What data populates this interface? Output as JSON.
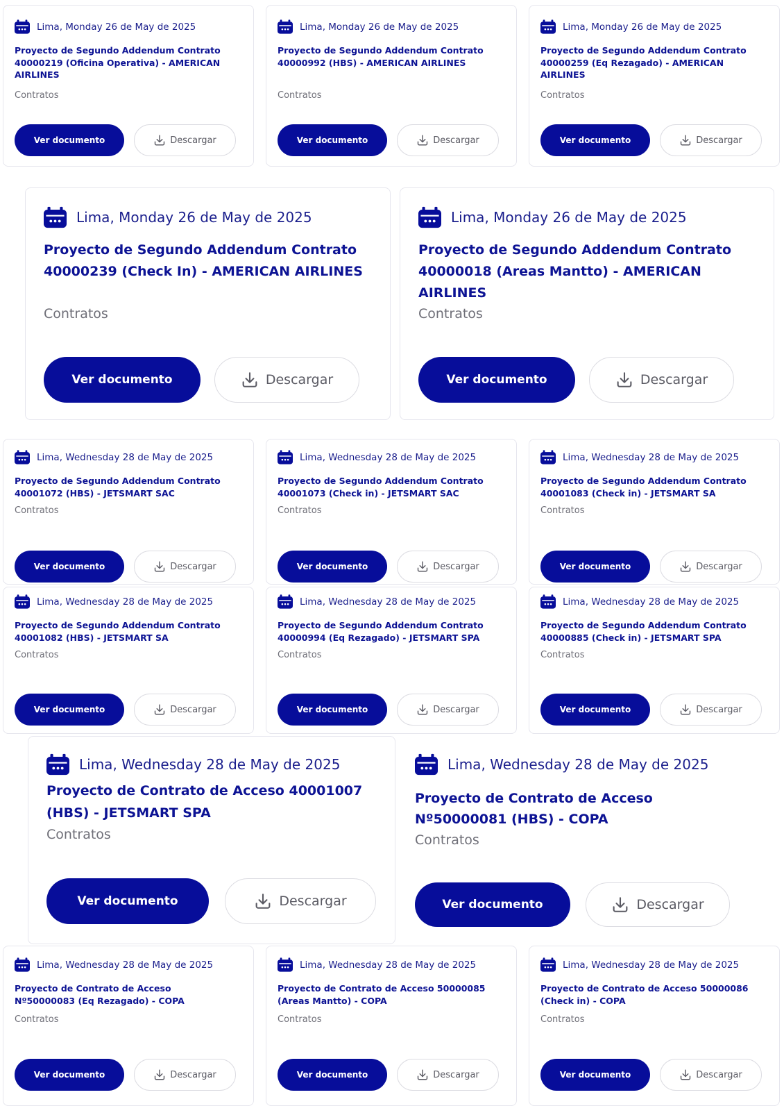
{
  "labels": {
    "view": "Ver documento",
    "download": "Descargar",
    "category": "Contratos"
  },
  "colors": {
    "primary": "#070d9a",
    "title": "#0d1394",
    "muted": "#6f6f78",
    "border": "#e6e6ee"
  },
  "icons": {
    "date": "calendar-icon",
    "download": "download-icon"
  },
  "cards": [
    {
      "date": "Lima, Monday 26 de May de 2025",
      "title": "Proyecto de Segundo Addendum Contrato 40000219 (Oficina Operativa) - AMERICAN AIRLINES",
      "category": "Contratos"
    },
    {
      "date": "Lima, Monday 26 de May de 2025",
      "title": "Proyecto de Segundo Addendum Contrato 40000992 (HBS) - AMERICAN AIRLINES",
      "category": "Contratos"
    },
    {
      "date": "Lima, Monday 26 de May de 2025",
      "title": "Proyecto de Segundo Addendum Contrato 40000259 (Eq Rezagado) - AMERICAN AIRLINES",
      "category": "Contratos"
    },
    {
      "date": "Lima, Monday 26 de May de 2025",
      "title": "Proyecto de Segundo Addendum Contrato 40000239 (Check In) - AMERICAN AIRLINES",
      "category": "Contratos"
    },
    {
      "date": "Lima, Monday 26 de May de 2025",
      "title": "Proyecto de Segundo Addendum Contrato 40000018 (Areas Mantto) - AMERICAN AIRLINES",
      "category": "Contratos"
    },
    {
      "date": "Lima, Wednesday 28 de May de 2025",
      "title": "Proyecto de Segundo Addendum Contrato 40001072 (HBS) - JETSMART SAC",
      "category": "Contratos"
    },
    {
      "date": "Lima, Wednesday 28 de May de 2025",
      "title": "Proyecto de Segundo Addendum Contrato 40001073 (Check in) - JETSMART SAC",
      "category": "Contratos"
    },
    {
      "date": "Lima, Wednesday 28 de May de 2025",
      "title": "Proyecto de Segundo Addendum Contrato 40001083 (Check in) - JETSMART SA",
      "category": "Contratos"
    },
    {
      "date": "Lima, Wednesday 28 de May de 2025",
      "title": "Proyecto de Segundo Addendum Contrato 40001082 (HBS) - JETSMART SA",
      "category": "Contratos"
    },
    {
      "date": "Lima, Wednesday 28 de May de 2025",
      "title": "Proyecto de Segundo Addendum Contrato 40000994 (Eq Rezagado) - JETSMART SPA",
      "category": "Contratos"
    },
    {
      "date": "Lima, Wednesday 28 de May de 2025",
      "title": "Proyecto de Segundo Addendum Contrato 40000885 (Check in) - JETSMART SPA",
      "category": "Contratos"
    },
    {
      "date": "Lima, Wednesday 28 de May de 2025",
      "title": "Proyecto de Contrato de Acceso 40001007 (HBS) - JETSMART SPA",
      "category": "Contratos"
    },
    {
      "date": "Lima, Wednesday 28 de May de 2025",
      "title": "Proyecto de Contrato de Acceso Nº50000081 (HBS) - COPA",
      "category": "Contratos"
    },
    {
      "date": "Lima, Wednesday 28 de May de 2025",
      "title": "Proyecto de Contrato de Acceso Nº50000083 (Eq Rezagado) - COPA",
      "category": "Contratos"
    },
    {
      "date": "Lima, Wednesday 28 de May de 2025",
      "title": "Proyecto de Contrato de Acceso 50000085 (Areas Mantto) - COPA",
      "category": "Contratos"
    },
    {
      "date": "Lima, Wednesday 28 de May de 2025",
      "title": "Proyecto de Contrato de Acceso 50000086 (Check in) - COPA",
      "category": "Contratos"
    }
  ]
}
